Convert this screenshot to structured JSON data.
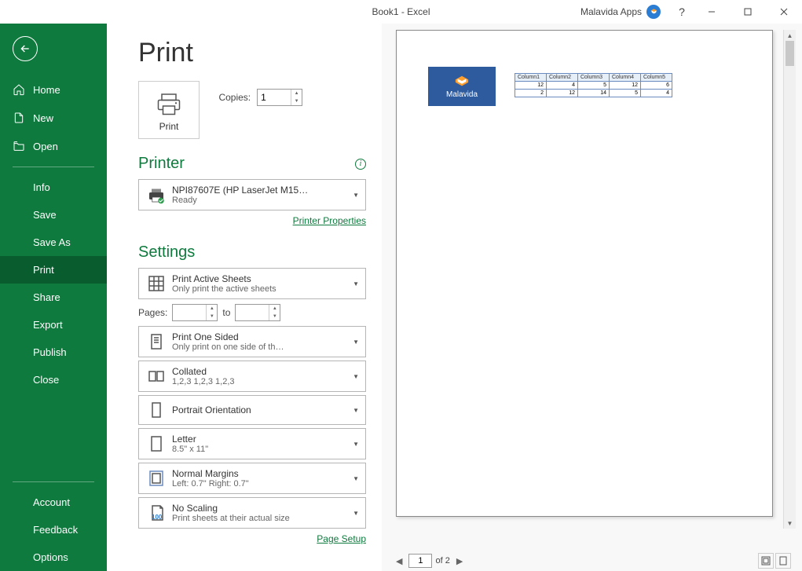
{
  "titlebar": {
    "title": "Book1  -  Excel",
    "apps_label": "Malavida Apps",
    "help": "?"
  },
  "sidebar": {
    "home": "Home",
    "new": "New",
    "open": "Open",
    "info": "Info",
    "save": "Save",
    "saveas": "Save As",
    "print": "Print",
    "share": "Share",
    "export": "Export",
    "publish": "Publish",
    "close": "Close",
    "account": "Account",
    "feedback": "Feedback",
    "options": "Options"
  },
  "page": {
    "title": "Print",
    "print_btn": "Print",
    "copies_label": "Copies:",
    "copies_value": "1"
  },
  "printer": {
    "heading": "Printer",
    "name": "NPI87607E (HP LaserJet M15…",
    "status": "Ready",
    "properties_link": "Printer Properties"
  },
  "settings": {
    "heading": "Settings",
    "active_sheets": {
      "title": "Print Active Sheets",
      "sub": "Only print the active sheets"
    },
    "pages_label": "Pages:",
    "pages_to": "to",
    "sided": {
      "title": "Print One Sided",
      "sub": "Only print on one side of th…"
    },
    "collated": {
      "title": "Collated",
      "sub": "1,2,3    1,2,3    1,2,3"
    },
    "orientation": {
      "title": "Portrait Orientation"
    },
    "paper": {
      "title": "Letter",
      "sub": "8.5\" x 11\""
    },
    "margins": {
      "title": "Normal Margins",
      "sub": "Left:  0.7\"    Right:  0.7\""
    },
    "scaling": {
      "title": "No Scaling",
      "sub": "Print sheets at their actual size",
      "num": "100"
    },
    "page_setup_link": "Page Setup"
  },
  "preview": {
    "logo_text": "Malavida",
    "current_page": "1",
    "total_pages_label": "of 2",
    "table": {
      "headers": [
        "Column1",
        "Column2",
        "Column3",
        "Column4",
        "Column5"
      ],
      "rows": [
        [
          "12",
          "4",
          "5",
          "12",
          "6"
        ],
        [
          "2",
          "12",
          "14",
          "5",
          "4"
        ]
      ]
    }
  }
}
